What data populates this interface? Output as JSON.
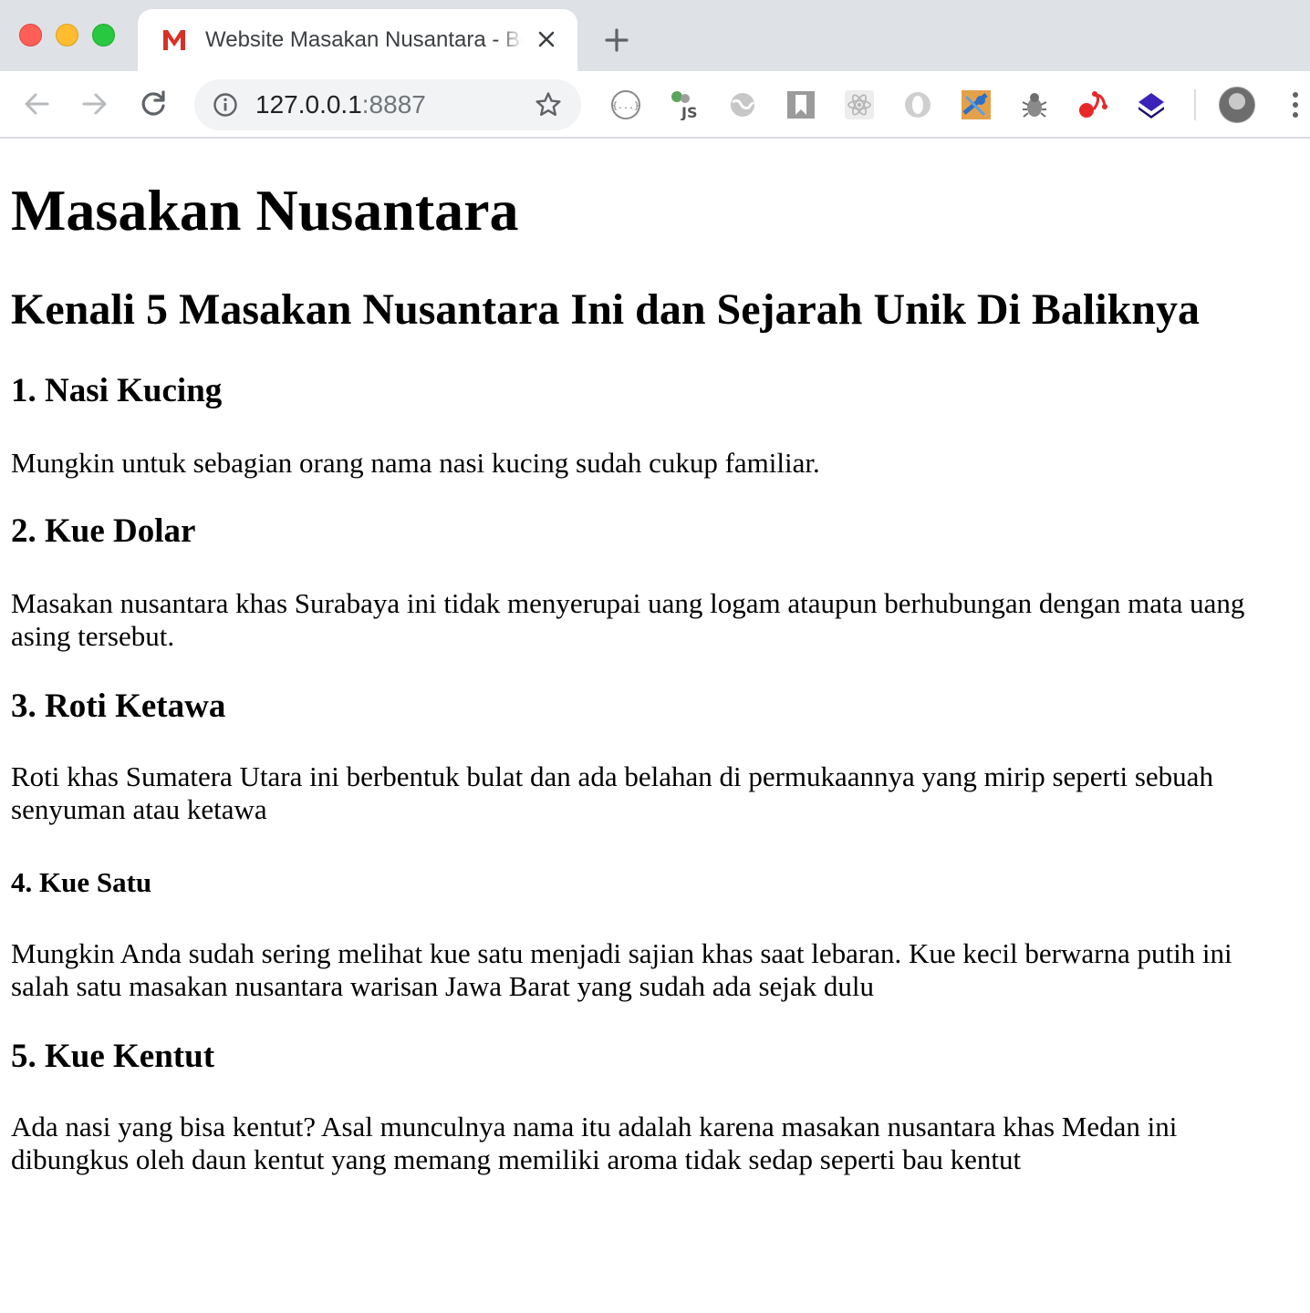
{
  "browser": {
    "tab": {
      "title": "Website Masakan Nusantara - Beranda",
      "favicon": "gmail-m-icon"
    },
    "address_bar": {
      "host": "127.0.0.1",
      "port": ":8887"
    },
    "extensions": [
      "json-viewer-icon",
      "js-icon",
      "globe-icon",
      "bookmark-icon",
      "react-devtools-icon",
      "opera-icon",
      "xpath-icon",
      "bug-icon",
      "redux-icon",
      "layers-icon"
    ]
  },
  "page": {
    "heading": "Masakan Nusantara",
    "subheading": "Kenali 5 Masakan Nusantara Ini dan Sejarah Unik Di Baliknya",
    "items": [
      {
        "title": "1. Nasi Kucing",
        "text": "Mungkin untuk sebagian orang nama nasi kucing sudah cukup familiar."
      },
      {
        "title": "2. Kue Dolar",
        "text": "Masakan nusantara khas Surabaya ini tidak menyerupai uang logam ataupun berhubungan dengan mata uang asing tersebut."
      },
      {
        "title": "3. Roti Ketawa",
        "text": "Roti khas Sumatera Utara ini berbentuk bulat dan ada belahan di permukaannya yang mirip seperti sebuah senyuman atau ketawa"
      },
      {
        "title": "4. Kue Satu",
        "text": "Mungkin Anda sudah sering melihat kue satu menjadi sajian khas saat lebaran. Kue kecil berwarna putih ini salah satu masakan nusantara warisan Jawa Barat yang sudah ada sejak dulu"
      },
      {
        "title": "5. Kue Kentut",
        "text": "Ada nasi yang bisa kentut? Asal munculnya nama itu adalah karena masakan nusantara khas Medan ini dibungkus oleh daun kentut yang memang memiliki aroma tidak sedap seperti bau kentut"
      }
    ]
  }
}
